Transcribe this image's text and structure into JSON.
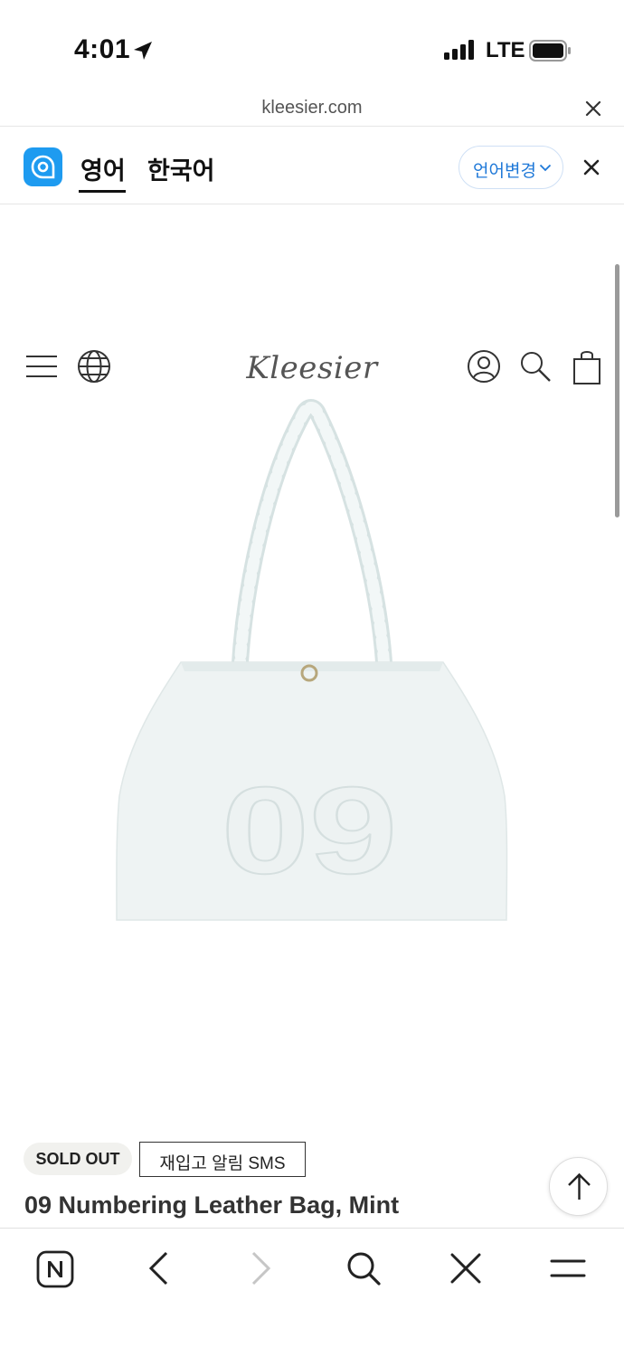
{
  "status_bar": {
    "time": "4:01",
    "network": "LTE"
  },
  "browser": {
    "url": "kleesier.com"
  },
  "translate_bar": {
    "languages": [
      "영어",
      "한국어"
    ],
    "active_language": "영어",
    "change_language_label": "언어변경",
    "accent_color": "#1e78d8"
  },
  "site_header": {
    "brand": "Kleesier",
    "icons": [
      "menu-icon",
      "globe-icon",
      "account-icon",
      "search-icon",
      "shopping-bag-icon"
    ]
  },
  "product": {
    "badge": "SOLD OUT",
    "restock_button": "재입고 알림 SMS",
    "title": "09 Numbering Leather Bag, Mint",
    "image_number": "09"
  },
  "toolbar": {
    "icons": [
      "naver-n-icon",
      "back-icon",
      "forward-icon",
      "search-icon",
      "close-icon",
      "menu-icon"
    ]
  }
}
